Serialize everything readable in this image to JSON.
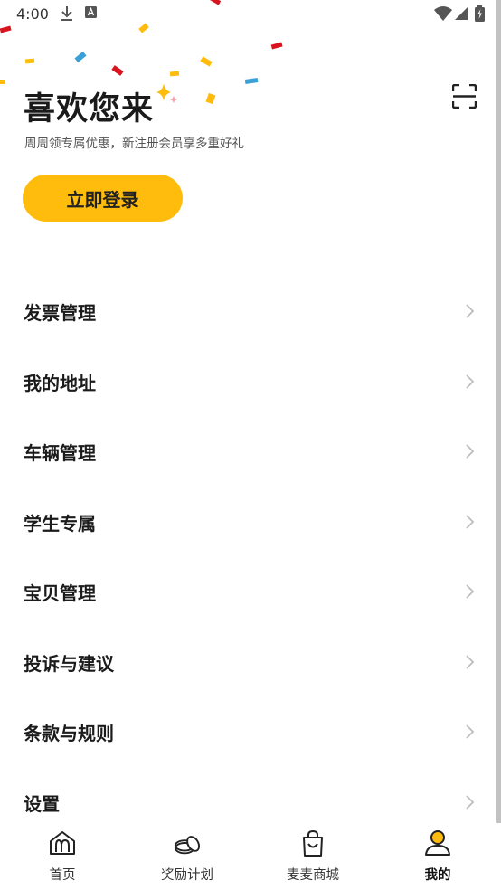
{
  "status_bar": {
    "time": "4:00"
  },
  "header": {
    "title": "喜欢您来",
    "subtitle": "周周领专属优惠，新注册会员享多重好礼",
    "login_label": "立即登录"
  },
  "menu": {
    "items": [
      {
        "label": "发票管理"
      },
      {
        "label": "我的地址"
      },
      {
        "label": "车辆管理"
      },
      {
        "label": "学生专属"
      },
      {
        "label": "宝贝管理"
      },
      {
        "label": "投诉与建议"
      },
      {
        "label": "条款与规则"
      },
      {
        "label": "设置"
      }
    ]
  },
  "tabbar": {
    "tabs": [
      {
        "label": "首页",
        "icon": "home-arch-icon"
      },
      {
        "label": "奖励计划",
        "icon": "coins-icon"
      },
      {
        "label": "麦麦商城",
        "icon": "shopping-bag-icon"
      },
      {
        "label": "我的",
        "icon": "profile-icon",
        "active": true
      }
    ]
  },
  "colors": {
    "accent": "#ffbc0d",
    "text": "#1b1b1b"
  }
}
